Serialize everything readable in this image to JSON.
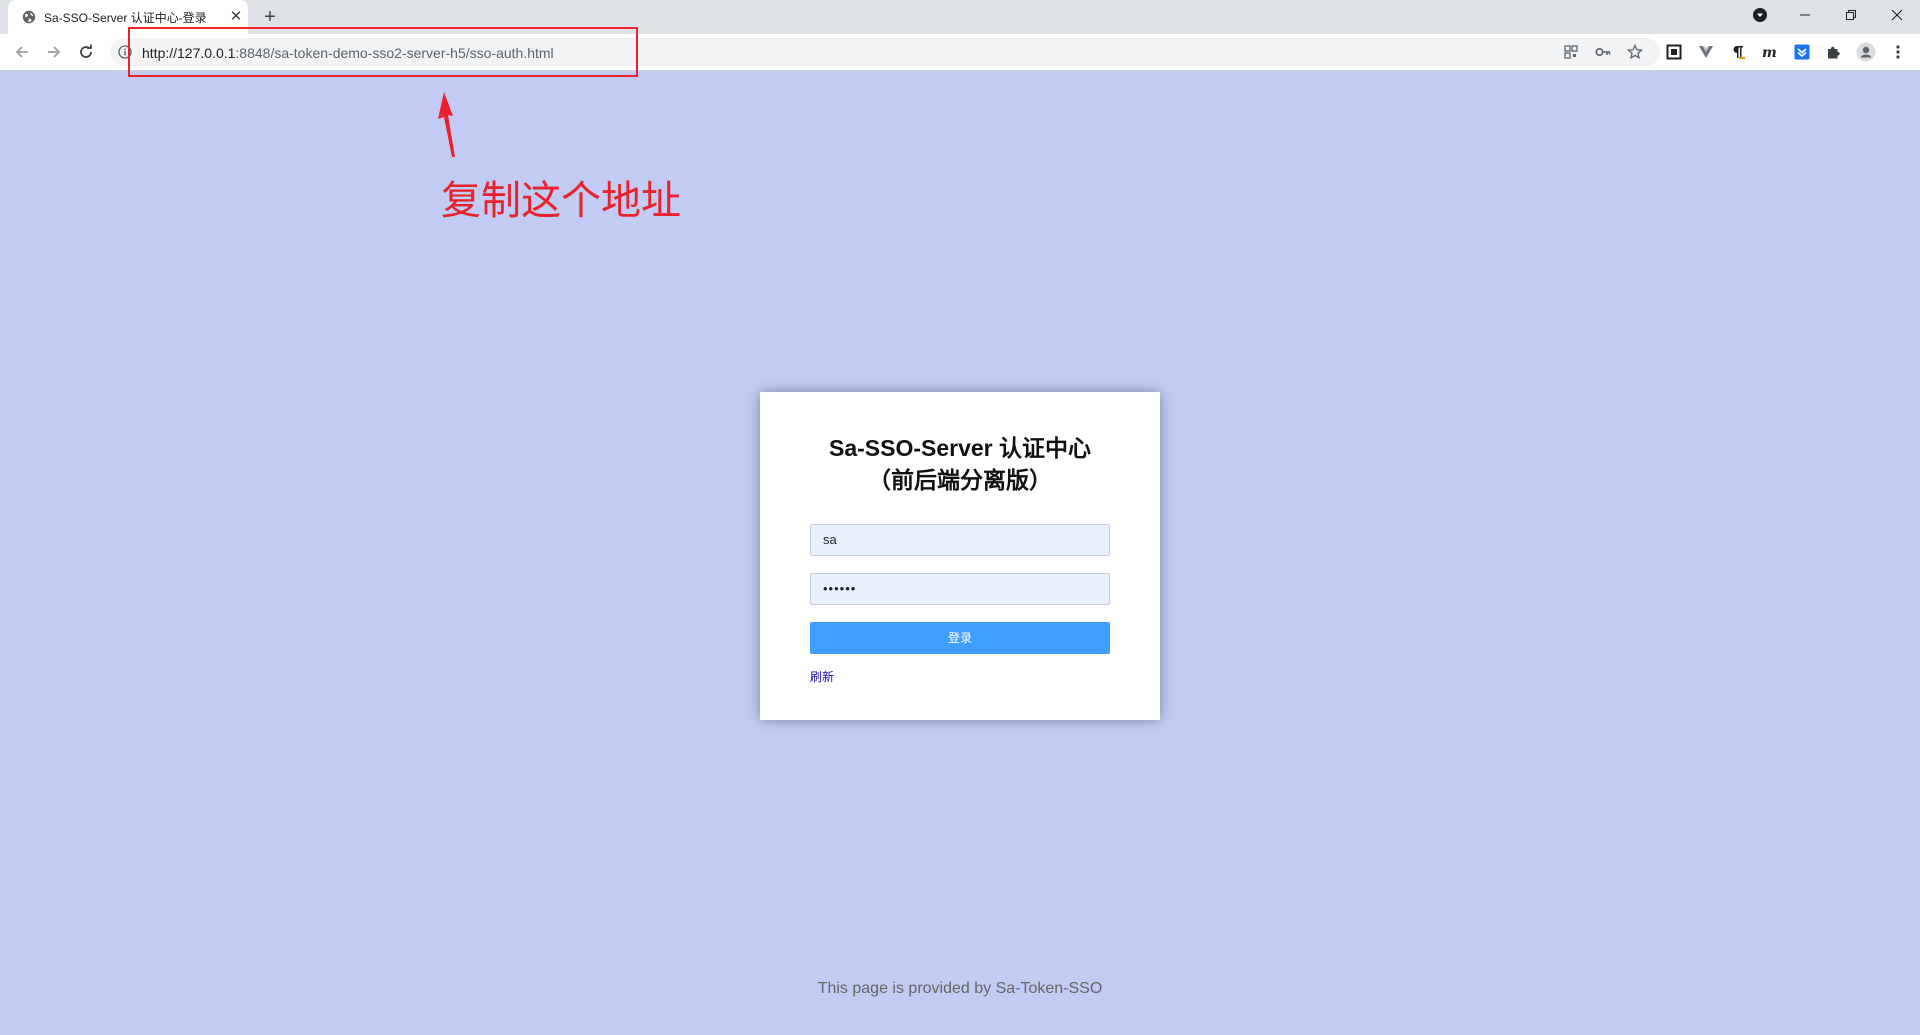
{
  "browser": {
    "tab": {
      "title": "Sa-SSO-Server 认证中心-登录",
      "close_glyph": "✕"
    },
    "new_tab_glyph": "+",
    "address": {
      "url_host": "http://127.0.0.1",
      "url_rest": ":8848/sa-token-demo-sso2-server-h5/sso-auth.html"
    },
    "icons": {
      "favicon": "globe-icon",
      "back": "arrow-left-icon",
      "forward": "arrow-right-icon",
      "reload": "reload-icon",
      "info": "info-icon",
      "qr": "qr-code-icon",
      "key": "key-icon",
      "star": "star-icon",
      "profile": "profile-icon",
      "menu": "kebab-menu-icon"
    }
  },
  "annotation": {
    "text": "复制这个地址",
    "color": "#e8212a"
  },
  "login": {
    "title_line1": "Sa-SSO-Server 认证中心",
    "title_line2": "（前后端分离版）",
    "username_value": "sa",
    "password_value": "••••••",
    "submit_label": "登录",
    "refresh_label": "刷新"
  },
  "footer": {
    "text": "This page is provided by Sa-Token-SSO"
  },
  "colors": {
    "page_bg": "#c1cbf4",
    "button_bg": "#409eff",
    "input_bg": "#e8f0fe"
  }
}
